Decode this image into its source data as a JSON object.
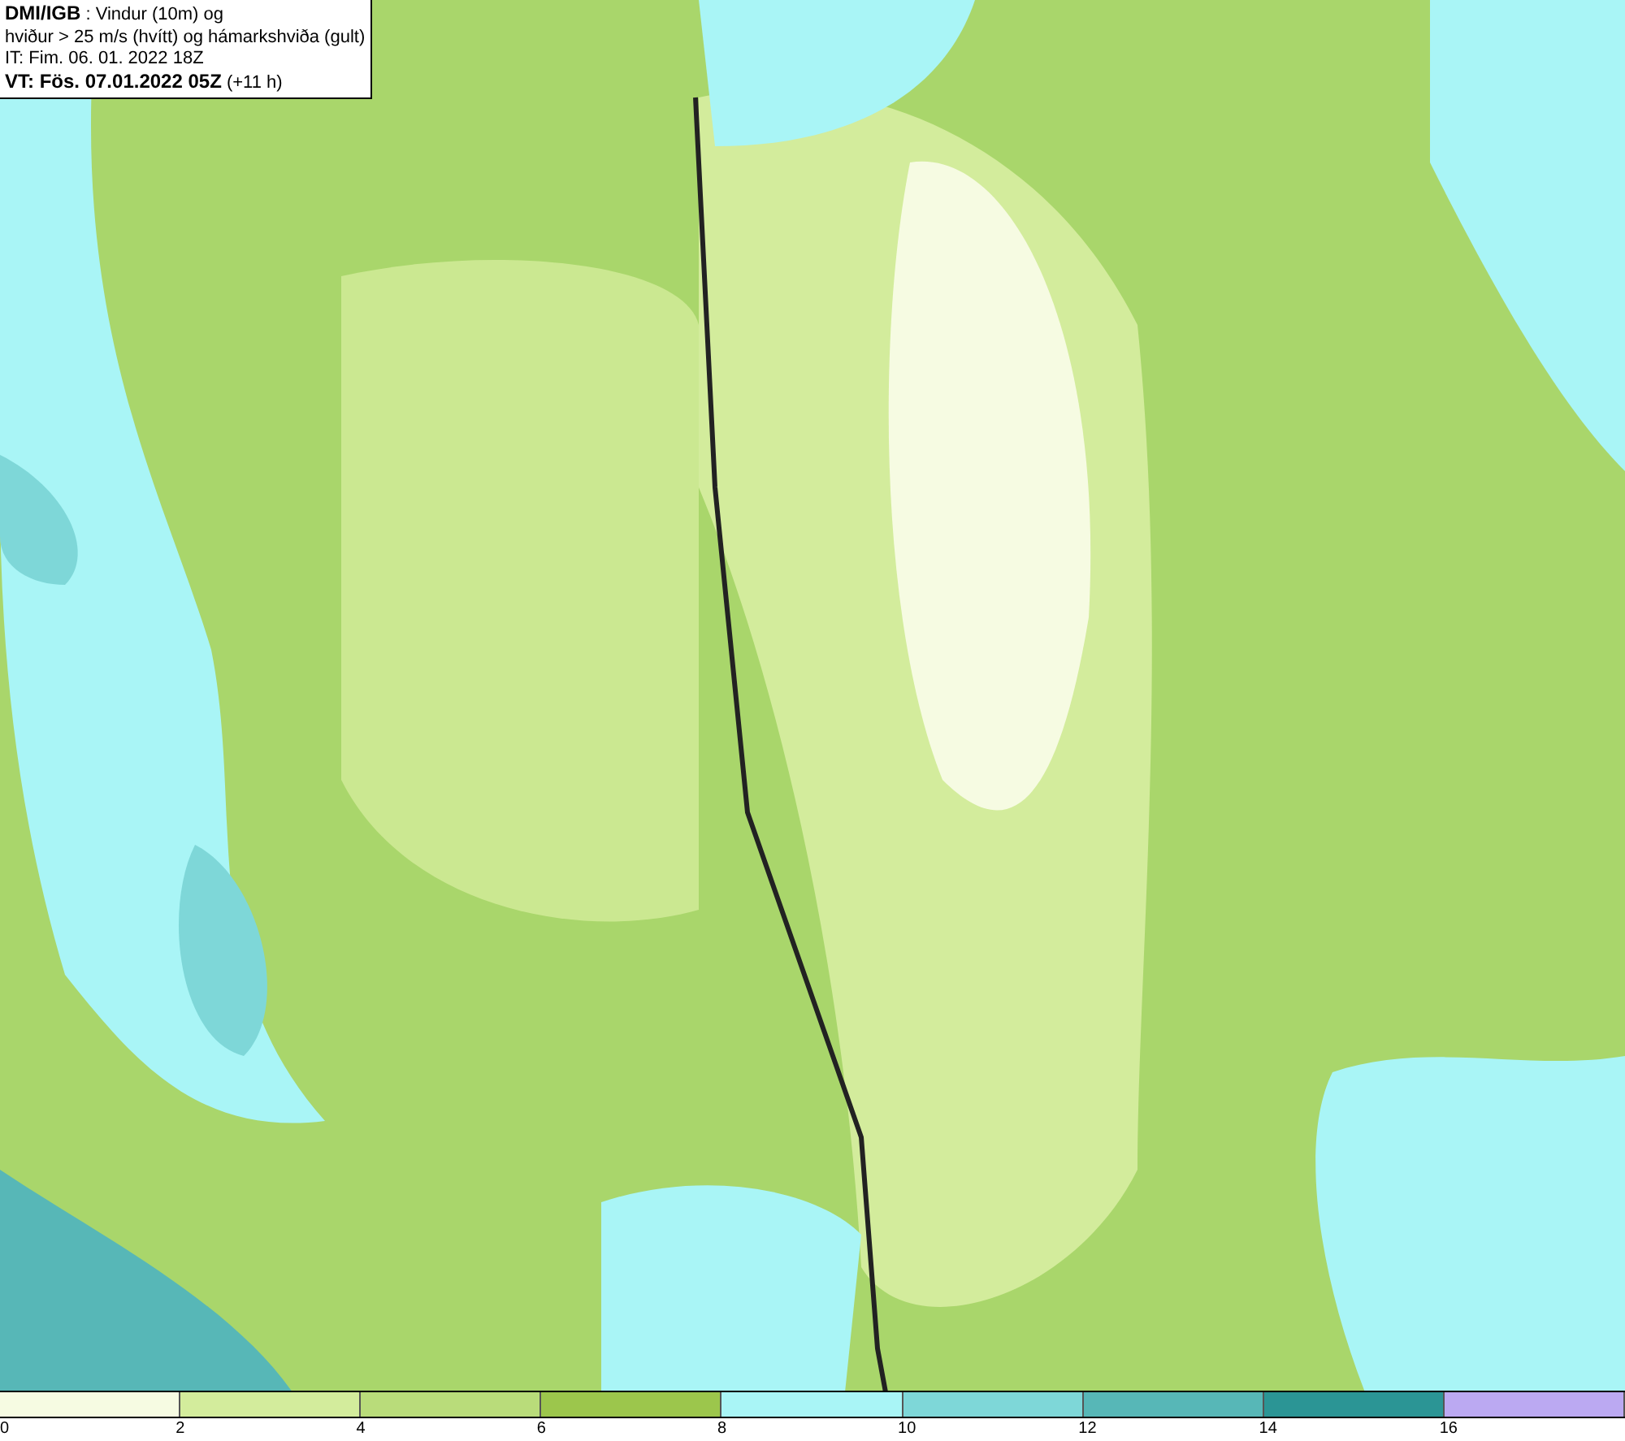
{
  "title_box": {
    "lines": [
      "**DMI/IGB** : Vindur (10m) og",
      "hviður > 25 m/s (hvítt) og hámarkshviða (gult)",
      "IT: Fim. 06. 01. 2022 18Z",
      "**VT: Fös. 07.01.2022 05Z** (+11 h)"
    ]
  },
  "colorbar": {
    "segments": [
      {
        "color": "#f6fbe2",
        "label": "0"
      },
      {
        "color": "#d3ec9c",
        "label": "2"
      },
      {
        "color": "#b9dc7a",
        "label": "4"
      },
      {
        "color": "#9cc64c",
        "label": "6"
      },
      {
        "color": "#a9f5f6",
        "label": "8"
      },
      {
        "color": "#7ed7d8",
        "label": "10"
      },
      {
        "color": "#57b7b7",
        "label": "12"
      },
      {
        "color": "#2b9595",
        "label": "14"
      },
      {
        "color": "#bba9f2",
        "label": "16"
      }
    ]
  }
}
